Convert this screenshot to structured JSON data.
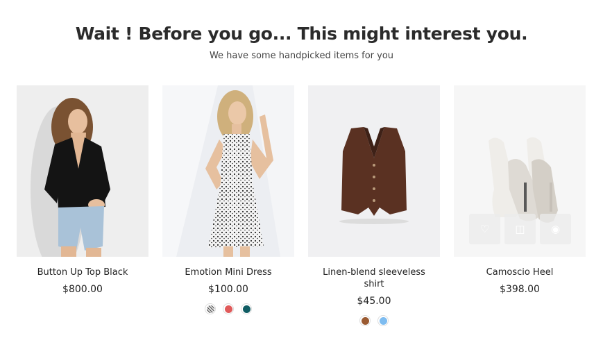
{
  "popup": {
    "title": "Wait ! Before you go... This might interest you.",
    "subtitle": "We have some handpicked items for you"
  },
  "products": [
    {
      "name": "Button Up Top Black",
      "price": "$800.00",
      "image_icon": "woman-black-top-photo",
      "swatches": []
    },
    {
      "name": "Emotion Mini Dress",
      "price": "$100.00",
      "image_icon": "woman-mini-dress-photo",
      "swatches": [
        {
          "name": "pattern",
          "color": "#9a9a9a"
        },
        {
          "name": "red",
          "color": "#e05a5a"
        },
        {
          "name": "teal",
          "color": "#0f5c63"
        }
      ]
    },
    {
      "name": "Linen-blend sleeveless shirt",
      "price": "$45.00",
      "image_icon": "brown-vest-photo",
      "swatches": [
        {
          "name": "brown",
          "color": "#9a5a32"
        },
        {
          "name": "light-blue",
          "color": "#7ebcf0"
        }
      ]
    },
    {
      "name": "Camoscio Heel",
      "price": "$398.00",
      "image_icon": "beige-heels-photo",
      "swatches": [],
      "quick_actions": [
        "heart-icon",
        "bag-icon",
        "eye-icon"
      ]
    }
  ]
}
